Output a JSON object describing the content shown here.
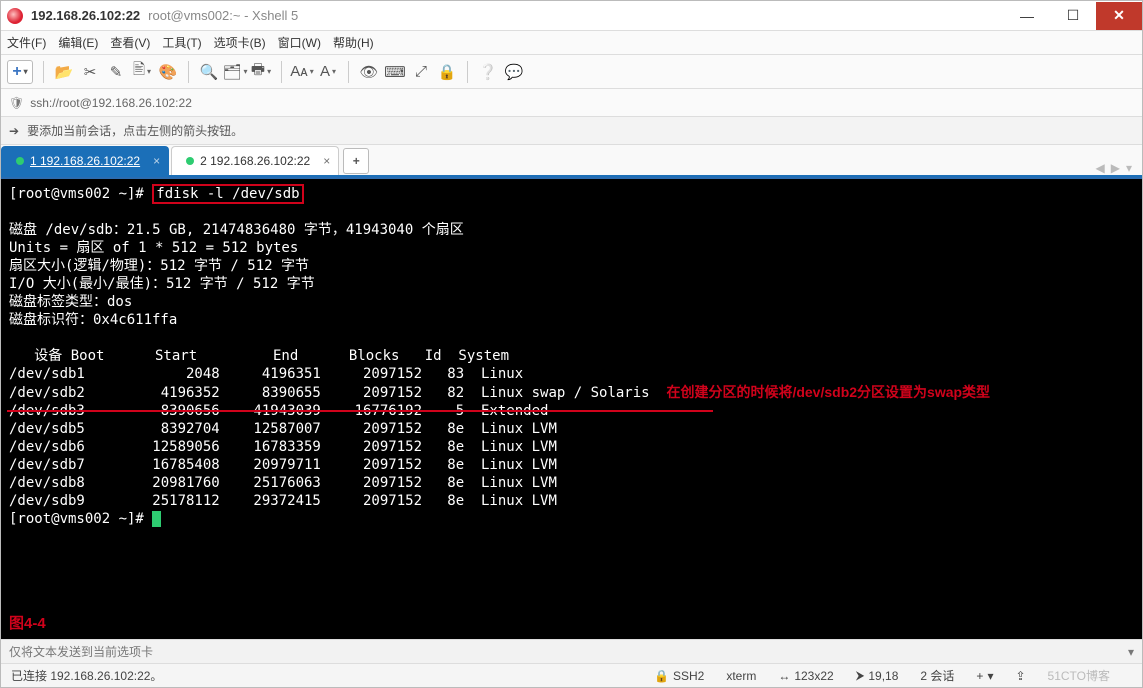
{
  "window": {
    "title_main": "192.168.26.102:22",
    "title_sub": "root@vms002:~ - Xshell 5"
  },
  "menu": {
    "file": "文件(F)",
    "edit": "编辑(E)",
    "view": "查看(V)",
    "tools": "工具(T)",
    "tab": "选项卡(B)",
    "window": "窗口(W)",
    "help": "帮助(H)"
  },
  "toolbar": {
    "add": "+",
    "items": [
      "folder",
      "cut",
      "pencil",
      "doc",
      "palette",
      "search",
      "folders",
      "printer",
      "font",
      "letter",
      "eye",
      "keyboard",
      "expand",
      "lock",
      "question",
      "chat"
    ]
  },
  "address": {
    "url": "ssh://root@192.168.26.102:22"
  },
  "info": {
    "msg": "要添加当前会话，点击左侧的箭头按钮。"
  },
  "tabs": {
    "items": [
      {
        "label": "1 192.168.26.102:22",
        "active": true
      },
      {
        "label": "2 192.168.26.102:22",
        "active": false
      }
    ],
    "add": "+"
  },
  "terminal": {
    "prompt1": "[root@vms002 ~]# ",
    "cmd1": "fdisk -l /dev/sdb",
    "blank1": "",
    "disk_info": "磁盘 /dev/sdb：21.5 GB, 21474836480 字节，41943040 个扇区",
    "units": "Units = 扇区 of 1 * 512 = 512 bytes",
    "sector": "扇区大小(逻辑/物理)：512 字节 / 512 字节",
    "io": "I/O 大小(最小/最佳)：512 字节 / 512 字节",
    "label": "磁盘标签类型：dos",
    "diskid": "磁盘标识符：0x4c611ffa",
    "blank2": "",
    "header": "   设备 Boot      Start         End      Blocks   Id  System",
    "rows": {
      "r1": "/dev/sdb1            2048     4196351     2097152   83  Linux",
      "r2": "/dev/sdb2         4196352     8390655     2097152   82  Linux swap / Solaris",
      "r3": "/dev/sdb3         8390656    41943039    16776192    5  Extended",
      "r4": "/dev/sdb5         8392704    12587007     2097152   8e  Linux LVM",
      "r5": "/dev/sdb6        12589056    16783359     2097152   8e  Linux LVM",
      "r6": "/dev/sdb7        16785408    20979711     2097152   8e  Linux LVM",
      "r7": "/dev/sdb8        20981760    25176063     2097152   8e  Linux LVM",
      "r8": "/dev/sdb9        25178112    29372415     2097152   8e  Linux LVM"
    },
    "annotation": "在创建分区的时候将/dev/sdb2分区设置为swap类型",
    "prompt2": "[root@vms002 ~]# ",
    "fig": "图4-4"
  },
  "sendbar": {
    "text": "仅将文本发送到当前选项卡"
  },
  "status": {
    "connected": "已连接 192.168.26.102:22。",
    "proto": "SSH2",
    "term": "xterm",
    "size": "123x22",
    "pos": "19,18",
    "sessions": "2 会话",
    "watermark": "51CTO博客",
    "plus": "+",
    "arrows": "↔",
    "grid": "⮞"
  },
  "icons": {
    "folder": "📂",
    "cut": "✂",
    "pencil": "✎",
    "doc": "🖹",
    "palette": "🎨",
    "search": "🔍",
    "folders": "🗂",
    "printer": "🖶",
    "font": "Aᴀ",
    "letter": "A",
    "eye": "👁",
    "keyboard": "⌨",
    "expand": "⤢",
    "lock": "🔒",
    "question": "❔",
    "chat": "💬",
    "shield": "🛡",
    "arrowr": "➔",
    "caps": "⇪"
  }
}
